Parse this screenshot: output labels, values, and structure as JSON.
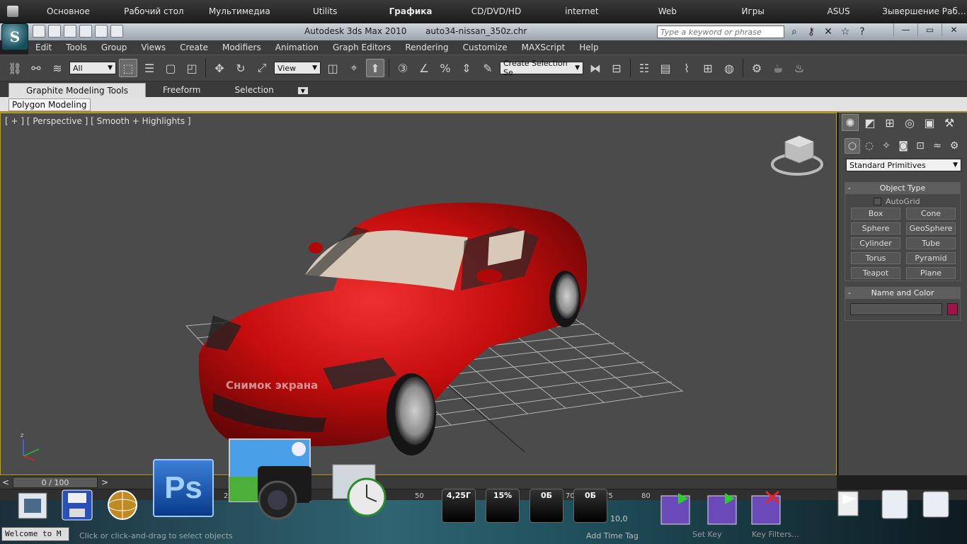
{
  "launcher": {
    "categories": [
      "Основное",
      "Рабочий стол",
      "Мультимедиа",
      "Utilits",
      "Графика",
      "CD/DVD/HD",
      "internet",
      "Web",
      "Игры",
      "ASUS",
      "Зывершение Раб…"
    ]
  },
  "titlebar": {
    "app_title": "Autodesk 3ds Max  2010",
    "file_name": "auto34-nissan_350z.chr",
    "search_placeholder": "Type a keyword or phrase"
  },
  "menu": [
    "Edit",
    "Tools",
    "Group",
    "Views",
    "Create",
    "Modifiers",
    "Animation",
    "Graph Editors",
    "Rendering",
    "Customize",
    "MAXScript",
    "Help"
  ],
  "toolbar": {
    "filter_value": "All",
    "coord_value": "View",
    "selection_set_placeholder": "Create Selection Se"
  },
  "ribbon": {
    "tabs": [
      "Graphite Modeling Tools",
      "Freeform",
      "Selection"
    ],
    "panel_tab": "Polygon Modeling"
  },
  "viewport": {
    "label": "[ + ] [ Perspective ] [ Smooth + Highlights ]",
    "watermark": "Снимок экрана",
    "car_color": "#cc1010",
    "interior_color": "#d8c8b8"
  },
  "command_panel": {
    "category": "Standard Primitives",
    "object_type_title": "Object Type",
    "autogrid": "AutoGrid",
    "primitives": [
      "Box",
      "Cone",
      "Sphere",
      "GeoSphere",
      "Cylinder",
      "Tube",
      "Torus",
      "Pyramid",
      "Teapot",
      "Plane"
    ],
    "name_color_title": "Name and Color",
    "object_color": "#a0124a"
  },
  "timeline": {
    "slider": "0 / 100",
    "ticks": [
      "25",
      "50",
      "70",
      "75",
      "80"
    ]
  },
  "status": {
    "maxscript": "Welcome to M",
    "hint": "Click or click-and-drag to select objects",
    "add_time_tag": "Add Time Tag",
    "set_key": "Set Key",
    "key_filters": "Key Filters...",
    "coord_value": "10,0"
  },
  "gadgets": {
    "mem": "4,25Г",
    "cpu": "15%",
    "net1": "0Б",
    "net2": "0Б"
  }
}
